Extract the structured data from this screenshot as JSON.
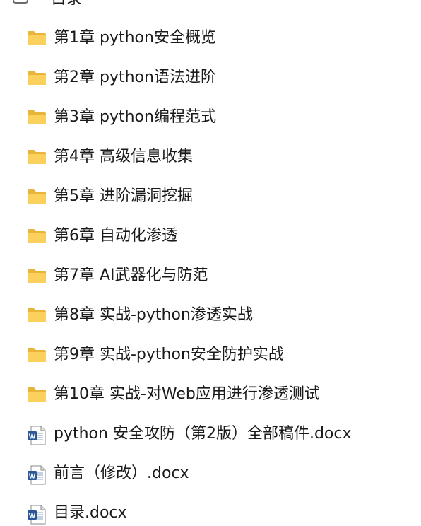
{
  "header": {
    "label": "目录"
  },
  "items": [
    {
      "type": "folder",
      "name": "第1章 python安全概览",
      "icon": "folder-icon"
    },
    {
      "type": "folder",
      "name": "第2章 python语法进阶",
      "icon": "folder-icon"
    },
    {
      "type": "folder",
      "name": "第3章 python编程范式",
      "icon": "folder-icon"
    },
    {
      "type": "folder",
      "name": "第4章 高级信息收集",
      "icon": "folder-icon"
    },
    {
      "type": "folder",
      "name": "第5章 进阶漏洞挖掘",
      "icon": "folder-icon"
    },
    {
      "type": "folder",
      "name": "第6章 自动化渗透",
      "icon": "folder-icon"
    },
    {
      "type": "folder",
      "name": "第7章 AI武器化与防范",
      "icon": "folder-icon"
    },
    {
      "type": "folder",
      "name": "第8章 实战-python渗透实战",
      "icon": "folder-icon"
    },
    {
      "type": "folder",
      "name": "第9章 实战-python安全防护实战",
      "icon": "folder-icon"
    },
    {
      "type": "folder",
      "name": "第10章 实战-对Web应用进行渗透测试",
      "icon": "folder-icon"
    },
    {
      "type": "docx",
      "name": "python 安全攻防（第2版）全部稿件.docx",
      "icon": "word-document-icon"
    },
    {
      "type": "docx",
      "name": "前言（修改）.docx",
      "icon": "word-document-icon"
    },
    {
      "type": "docx",
      "name": "目录.docx",
      "icon": "word-document-icon"
    }
  ],
  "colors": {
    "folder_back": "#e8b53a",
    "folder_front": "#fcd05c",
    "doc_blue": "#2b5797"
  }
}
